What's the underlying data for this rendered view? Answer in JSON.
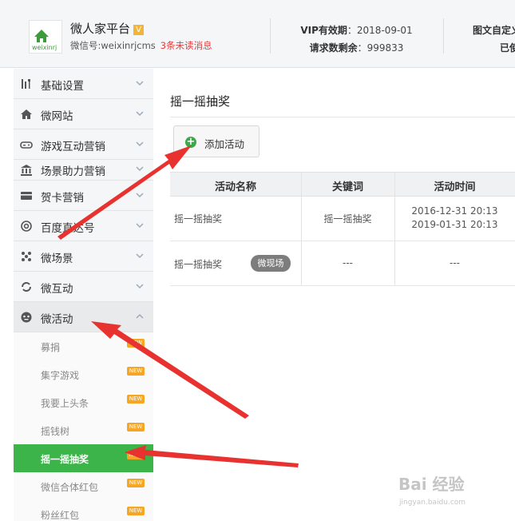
{
  "header": {
    "brand_name": "微人家平台",
    "vip_icon": "V",
    "logo_text": "weixinrj",
    "account_label": "微信号:weixinrjcms",
    "unread": "3条未读消息",
    "vip_label": "VIP有效期",
    "vip_date": "：2018-09-01",
    "requests_label": "请求数剩余",
    "requests_left": "：999833",
    "custom_reply_label": "图文自定义",
    "custom_reply_used": "已使"
  },
  "sidebar": {
    "items": [
      {
        "label": "基础设置",
        "icon": "tools-icon"
      },
      {
        "label": "微网站",
        "icon": "home-icon"
      },
      {
        "label": "游戏互动营销",
        "icon": "gamepad-icon"
      },
      {
        "label": "场景助力营销",
        "icon": "bank-icon"
      },
      {
        "label": "贺卡营销",
        "icon": "card-icon"
      },
      {
        "label": "百度直达号",
        "icon": "at-icon"
      },
      {
        "label": "微场景",
        "icon": "dots-icon"
      },
      {
        "label": "微互动",
        "icon": "refresh-icon"
      },
      {
        "label": "微活动",
        "icon": "mask-icon"
      }
    ],
    "sub_items": [
      {
        "label": "募捐",
        "badge": "NEW"
      },
      {
        "label": "集字游戏",
        "badge": "NEW"
      },
      {
        "label": "我要上头条",
        "badge": "NEW"
      },
      {
        "label": "摇钱树",
        "badge": "NEW"
      },
      {
        "label": "摇一摇抽奖",
        "badge": "NEW"
      },
      {
        "label": "微信合体红包",
        "badge": "NEW"
      },
      {
        "label": "粉丝红包",
        "badge": "NEW"
      }
    ],
    "active_sub": "摇一摇抽奖"
  },
  "main": {
    "title": "摇一摇抽奖",
    "add_button": "添加活动",
    "table": {
      "headers": [
        "活动名称",
        "关键词",
        "活动时间"
      ],
      "rows": [
        {
          "name": "摇一摇抽奖",
          "keyword": "摇一摇抽奖",
          "start": "2016-12-31 20:13",
          "end": "2019-01-31 20:13",
          "tag": ""
        },
        {
          "name": "摇一摇抽奖",
          "keyword": "---",
          "start": "---",
          "end": "",
          "tag": "微现场"
        }
      ]
    }
  },
  "watermark": {
    "text": "Bai 经验",
    "sub": "jingyan.baidu.com"
  },
  "colors": {
    "accent_green": "#3cb44a",
    "unread_red": "#e33d3d",
    "badge_orange": "#f6a623",
    "arrow_red": "#e8322f"
  }
}
